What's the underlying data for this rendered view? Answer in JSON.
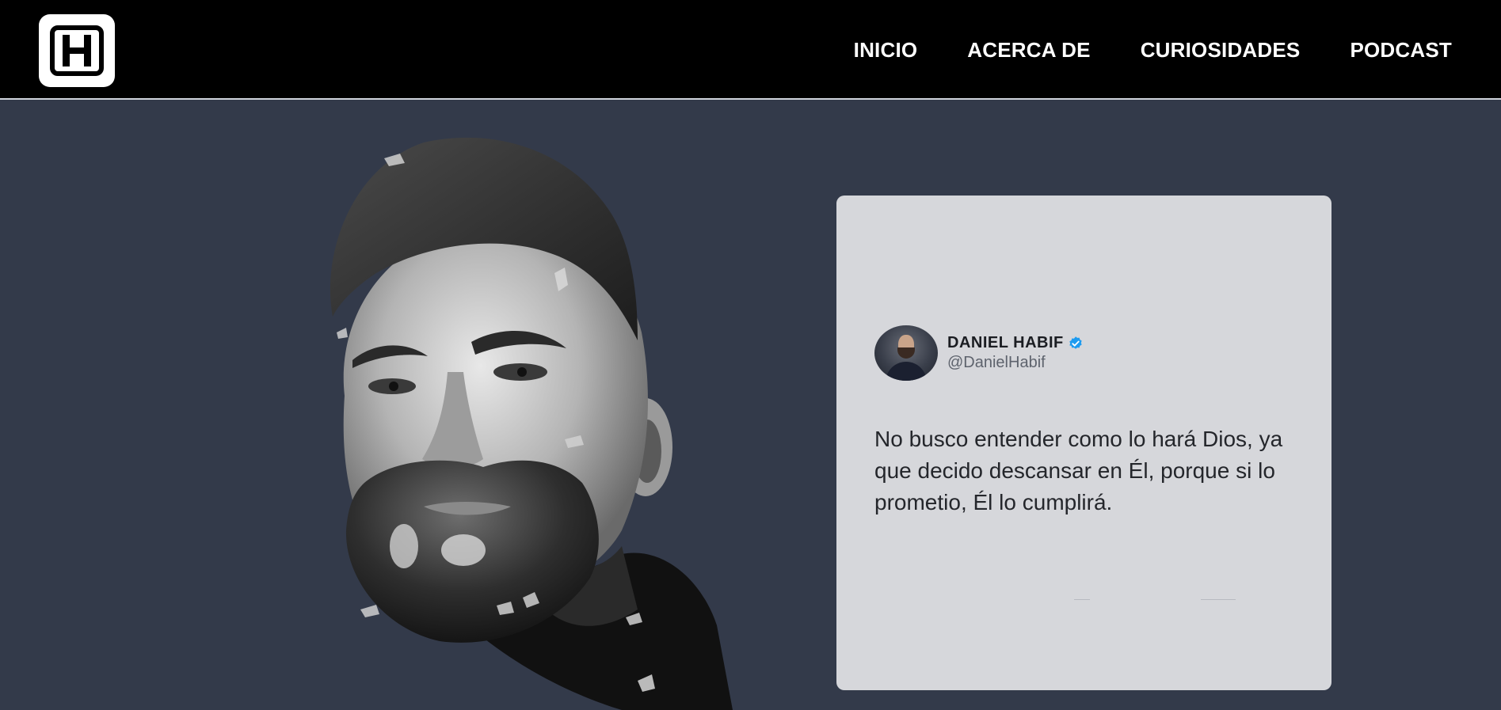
{
  "nav": {
    "logo_letter": "H",
    "items": [
      {
        "label": "INICIO"
      },
      {
        "label": "ACERCA DE"
      },
      {
        "label": "CURIOSIDADES"
      },
      {
        "label": "PODCAST"
      }
    ]
  },
  "tweet": {
    "name": "DANIEL HABIF",
    "handle": "@DanielHabif",
    "text": "No busco entender como lo hará Dios, ya que decido descansar en Él, porque si lo prometio, Él lo cumplirá.",
    "verified_icon": "verified-badge-icon"
  },
  "colors": {
    "page_background": "#333a4a",
    "nav_background": "#000000",
    "nav_text": "#ffffff",
    "card_background": "#d6d7db",
    "verified_blue": "#1d9bf0"
  }
}
